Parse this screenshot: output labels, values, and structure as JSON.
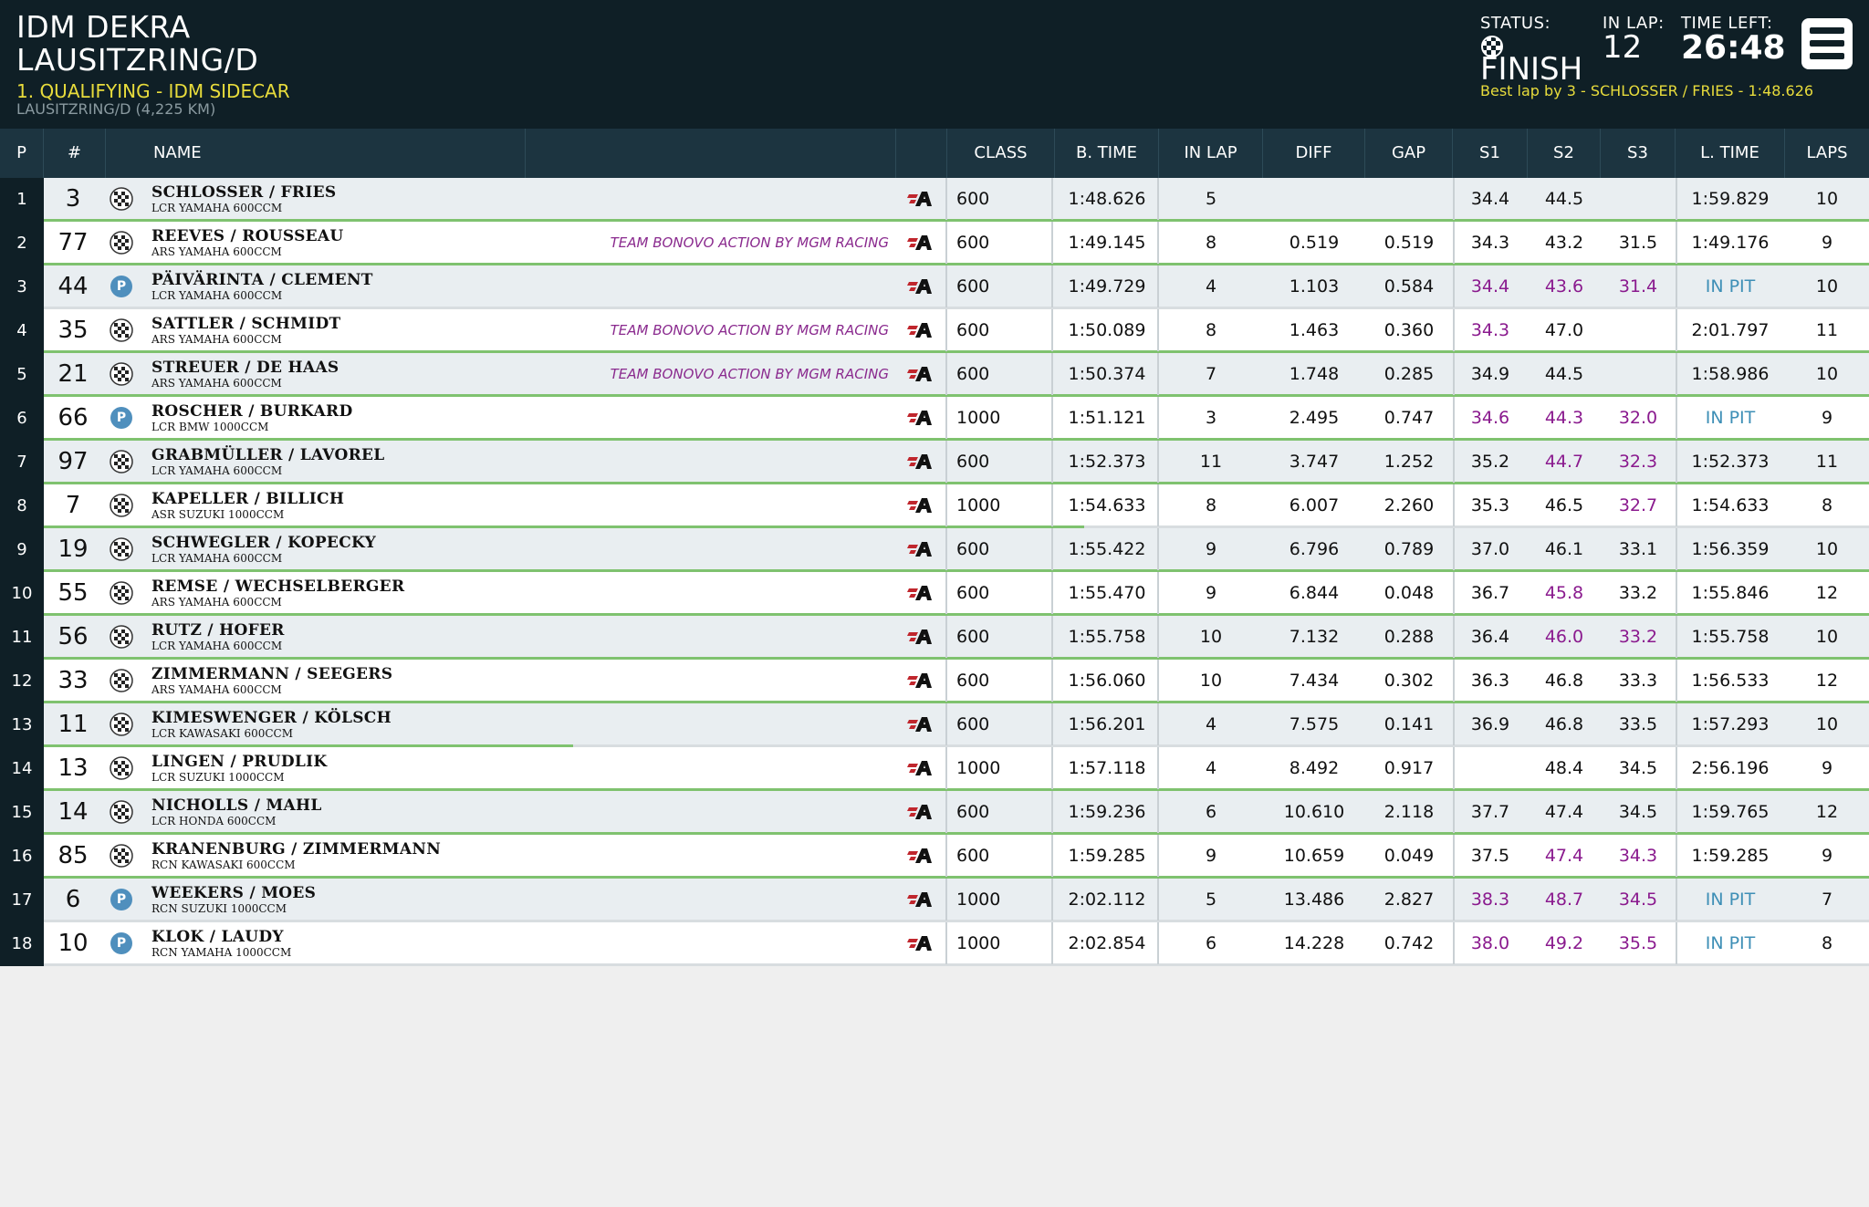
{
  "header": {
    "event_line1": "IDM DEKRA",
    "event_line2": "LAUSITZRING/D",
    "session": "1. QUALIFYING - IDM SIDECAR",
    "track": "LAUSITZRING/D (4,225 KM)",
    "status_label": "STATUS:",
    "status_value": "FINISH",
    "status_icon": "checkered-flag-icon",
    "inlap_label": "IN LAP:",
    "inlap_value": "12",
    "timeleft_label": "TIME LEFT:",
    "timeleft_value": "26:48",
    "best_lap": "Best lap by 3 - SCHLOSSER / FRIES - 1:48.626",
    "menu_icon": "hamburger-menu-icon"
  },
  "columns": {
    "p": "P",
    "num": "#",
    "name": "NAME",
    "class": "CLASS",
    "btime": "B. TIME",
    "inlap": "IN LAP",
    "diff": "DIFF",
    "gap": "GAP",
    "s1": "S1",
    "s2": "S2",
    "s3": "S3",
    "ltime": "L. TIME",
    "laps": "LAPS"
  },
  "colors": {
    "header_bg": "#0f1f26",
    "session_yellow": "#e8dc3c",
    "best_sector": "#8a1a8e",
    "in_pit": "#3e8fb6",
    "progress": "#7fc26f"
  },
  "rows": [
    {
      "p": "1",
      "num": "3",
      "name": "SCHLOSSER / FRIES",
      "bike": "LCR YAMAHA 600CCM",
      "team": "",
      "status": "flag",
      "cls": "600",
      "btime": "1:48.626",
      "inlap": "5",
      "diff": "",
      "gap": "",
      "s1": "34.4",
      "s2": "44.5",
      "s3": "",
      "ltime": "1:59.829",
      "laps": "10",
      "progress": 1.0,
      "s1_best": false,
      "s2_best": false,
      "s3_best": false,
      "pit": false
    },
    {
      "p": "2",
      "num": "77",
      "name": "REEVES / ROUSSEAU",
      "bike": "ARS YAMAHA 600CCM",
      "team": "TEAM BONOVO ACTION BY MGM RACING",
      "status": "flag",
      "cls": "600",
      "btime": "1:49.145",
      "inlap": "8",
      "diff": "0.519",
      "gap": "0.519",
      "s1": "34.3",
      "s2": "43.2",
      "s3": "31.5",
      "ltime": "1:49.176",
      "laps": "9",
      "progress": 1.0,
      "s1_best": false,
      "s2_best": false,
      "s3_best": false,
      "pit": false
    },
    {
      "p": "3",
      "num": "44",
      "name": "PÄIVÄRINTA / CLEMENT",
      "bike": "LCR YAMAHA 600CCM",
      "team": "",
      "status": "pit",
      "cls": "600",
      "btime": "1:49.729",
      "inlap": "4",
      "diff": "1.103",
      "gap": "0.584",
      "s1": "34.4",
      "s2": "43.6",
      "s3": "31.4",
      "ltime": "IN PIT",
      "laps": "10",
      "progress": 0,
      "s1_best": true,
      "s2_best": true,
      "s3_best": true,
      "pit": true
    },
    {
      "p": "4",
      "num": "35",
      "name": "SATTLER / SCHMIDT",
      "bike": "ARS YAMAHA 600CCM",
      "team": "TEAM BONOVO ACTION BY MGM RACING",
      "status": "flag",
      "cls": "600",
      "btime": "1:50.089",
      "inlap": "8",
      "diff": "1.463",
      "gap": "0.360",
      "s1": "34.3",
      "s2": "47.0",
      "s3": "",
      "ltime": "2:01.797",
      "laps": "11",
      "progress": 1.0,
      "s1_best": true,
      "s2_best": false,
      "s3_best": false,
      "pit": false
    },
    {
      "p": "5",
      "num": "21",
      "name": "STREUER / DE HAAS",
      "bike": "ARS YAMAHA 600CCM",
      "team": "TEAM BONOVO ACTION BY MGM RACING",
      "status": "flag",
      "cls": "600",
      "btime": "1:50.374",
      "inlap": "7",
      "diff": "1.748",
      "gap": "0.285",
      "s1": "34.9",
      "s2": "44.5",
      "s3": "",
      "ltime": "1:58.986",
      "laps": "10",
      "progress": 1.0,
      "s1_best": false,
      "s2_best": false,
      "s3_best": false,
      "pit": false
    },
    {
      "p": "6",
      "num": "66",
      "name": "ROSCHER / BURKARD",
      "bike": "LCR BMW 1000CCM",
      "team": "",
      "status": "pit",
      "cls": "1000",
      "btime": "1:51.121",
      "inlap": "3",
      "diff": "2.495",
      "gap": "0.747",
      "s1": "34.6",
      "s2": "44.3",
      "s3": "32.0",
      "ltime": "IN PIT",
      "laps": "9",
      "progress": 1.0,
      "s1_best": true,
      "s2_best": true,
      "s3_best": true,
      "pit": true
    },
    {
      "p": "7",
      "num": "97",
      "name": "GRABMÜLLER / LAVOREL",
      "bike": "LCR YAMAHA 600CCM",
      "team": "",
      "status": "flag",
      "cls": "600",
      "btime": "1:52.373",
      "inlap": "11",
      "diff": "3.747",
      "gap": "1.252",
      "s1": "35.2",
      "s2": "44.7",
      "s3": "32.3",
      "ltime": "1:52.373",
      "laps": "11",
      "progress": 1.0,
      "s1_best": false,
      "s2_best": true,
      "s3_best": true,
      "pit": false
    },
    {
      "p": "8",
      "num": "7",
      "name": "KAPELLER / BILLICH",
      "bike": "ASR SUZUKI 1000CCM",
      "team": "",
      "status": "flag",
      "cls": "1000",
      "btime": "1:54.633",
      "inlap": "8",
      "diff": "6.007",
      "gap": "2.260",
      "s1": "35.3",
      "s2": "46.5",
      "s3": "32.7",
      "ltime": "1:54.633",
      "laps": "8",
      "progress": 0.57,
      "s1_best": false,
      "s2_best": false,
      "s3_best": true,
      "pit": false
    },
    {
      "p": "9",
      "num": "19",
      "name": "SCHWEGLER / KOPECKY",
      "bike": "LCR YAMAHA 600CCM",
      "team": "",
      "status": "flag",
      "cls": "600",
      "btime": "1:55.422",
      "inlap": "9",
      "diff": "6.796",
      "gap": "0.789",
      "s1": "37.0",
      "s2": "46.1",
      "s3": "33.1",
      "ltime": "1:56.359",
      "laps": "10",
      "progress": 1.0,
      "s1_best": false,
      "s2_best": false,
      "s3_best": false,
      "pit": false
    },
    {
      "p": "10",
      "num": "55",
      "name": "REMSE / WECHSELBERGER",
      "bike": "ARS YAMAHA 600CCM",
      "team": "",
      "status": "flag",
      "cls": "600",
      "btime": "1:55.470",
      "inlap": "9",
      "diff": "6.844",
      "gap": "0.048",
      "s1": "36.7",
      "s2": "45.8",
      "s3": "33.2",
      "ltime": "1:55.846",
      "laps": "12",
      "progress": 1.0,
      "s1_best": false,
      "s2_best": true,
      "s3_best": false,
      "pit": false
    },
    {
      "p": "11",
      "num": "56",
      "name": "RUTZ / HOFER",
      "bike": "LCR YAMAHA 600CCM",
      "team": "",
      "status": "flag",
      "cls": "600",
      "btime": "1:55.758",
      "inlap": "10",
      "diff": "7.132",
      "gap": "0.288",
      "s1": "36.4",
      "s2": "46.0",
      "s3": "33.2",
      "ltime": "1:55.758",
      "laps": "10",
      "progress": 1.0,
      "s1_best": false,
      "s2_best": true,
      "s3_best": true,
      "pit": false
    },
    {
      "p": "12",
      "num": "33",
      "name": "ZIMMERMANN / SEEGERS",
      "bike": "ARS YAMAHA 600CCM",
      "team": "",
      "status": "flag",
      "cls": "600",
      "btime": "1:56.060",
      "inlap": "10",
      "diff": "7.434",
      "gap": "0.302",
      "s1": "36.3",
      "s2": "46.8",
      "s3": "33.3",
      "ltime": "1:56.533",
      "laps": "12",
      "progress": 1.0,
      "s1_best": false,
      "s2_best": false,
      "s3_best": false,
      "pit": false
    },
    {
      "p": "13",
      "num": "11",
      "name": "KIMESWENGER / KÖLSCH",
      "bike": "LCR KAWASAKI 600CCM",
      "team": "",
      "status": "flag",
      "cls": "600",
      "btime": "1:56.201",
      "inlap": "4",
      "diff": "7.575",
      "gap": "0.141",
      "s1": "36.9",
      "s2": "46.8",
      "s3": "33.5",
      "ltime": "1:57.293",
      "laps": "10",
      "progress": 0.29,
      "s1_best": false,
      "s2_best": false,
      "s3_best": false,
      "pit": false
    },
    {
      "p": "14",
      "num": "13",
      "name": "LINGEN / PRUDLIK",
      "bike": "LCR SUZUKI 1000CCM",
      "team": "",
      "status": "flag",
      "cls": "1000",
      "btime": "1:57.118",
      "inlap": "4",
      "diff": "8.492",
      "gap": "0.917",
      "s1": "",
      "s2": "48.4",
      "s3": "34.5",
      "ltime": "2:56.196",
      "laps": "9",
      "progress": 1.0,
      "s1_best": false,
      "s2_best": false,
      "s3_best": false,
      "pit": false
    },
    {
      "p": "15",
      "num": "14",
      "name": "NICHOLLS / MAHL",
      "bike": "LCR HONDA 600CCM",
      "team": "",
      "status": "flag",
      "cls": "600",
      "btime": "1:59.236",
      "inlap": "6",
      "diff": "10.610",
      "gap": "2.118",
      "s1": "37.7",
      "s2": "47.4",
      "s3": "34.5",
      "ltime": "1:59.765",
      "laps": "12",
      "progress": 1.0,
      "s1_best": false,
      "s2_best": false,
      "s3_best": false,
      "pit": false
    },
    {
      "p": "16",
      "num": "85",
      "name": "KRANENBURG / ZIMMERMANN",
      "bike": "RCN KAWASAKI 600CCM",
      "team": "",
      "status": "flag",
      "cls": "600",
      "btime": "1:59.285",
      "inlap": "9",
      "diff": "10.659",
      "gap": "0.049",
      "s1": "37.5",
      "s2": "47.4",
      "s3": "34.3",
      "ltime": "1:59.285",
      "laps": "9",
      "progress": 1.0,
      "s1_best": false,
      "s2_best": true,
      "s3_best": true,
      "pit": false
    },
    {
      "p": "17",
      "num": "6",
      "name": "WEEKERS / MOES",
      "bike": "RCN SUZUKI 1000CCM",
      "team": "",
      "status": "pit",
      "cls": "1000",
      "btime": "2:02.112",
      "inlap": "5",
      "diff": "13.486",
      "gap": "2.827",
      "s1": "38.3",
      "s2": "48.7",
      "s3": "34.5",
      "ltime": "IN PIT",
      "laps": "7",
      "progress": 0,
      "s1_best": true,
      "s2_best": true,
      "s3_best": true,
      "pit": true
    },
    {
      "p": "18",
      "num": "10",
      "name": "KLOK / LAUDY",
      "bike": "RCN YAMAHA 1000CCM",
      "team": "",
      "status": "pit",
      "cls": "1000",
      "btime": "2:02.854",
      "inlap": "6",
      "diff": "14.228",
      "gap": "0.742",
      "s1": "38.0",
      "s2": "49.2",
      "s3": "35.5",
      "ltime": "IN PIT",
      "laps": "8",
      "progress": 0,
      "s1_best": true,
      "s2_best": true,
      "s3_best": true,
      "pit": true
    }
  ]
}
